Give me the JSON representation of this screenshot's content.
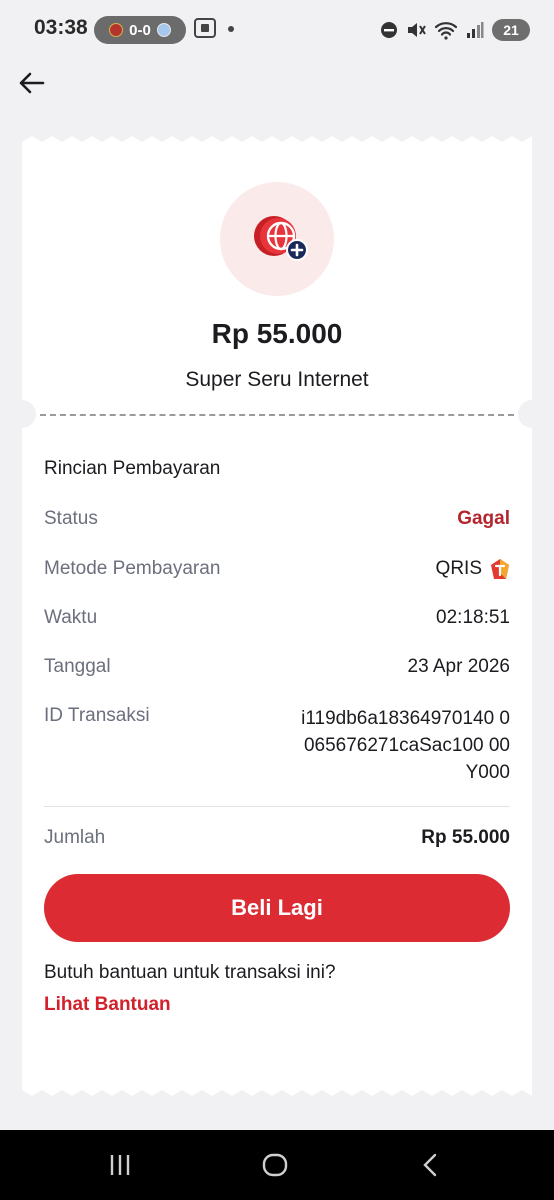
{
  "status_bar": {
    "time": "03:38",
    "score": "0-0",
    "battery": "21"
  },
  "receipt": {
    "amount": "Rp 55.000",
    "product_name": "Super Seru Internet",
    "details_title": "Rincian Pembayaran",
    "status_label": "Status",
    "status_value": "Gagal",
    "method_label": "Metode Pembayaran",
    "method_value": "QRIS",
    "time_label": "Waktu",
    "time_value": "02:18:51",
    "date_label": "Tanggal",
    "date_value": "23 Apr 2026",
    "txid_label": "ID Transaksi",
    "txid_value": "i119db6a18364970140 0065676271caSac100 00Y000",
    "total_label": "Jumlah",
    "total_value": "Rp 55.000",
    "buy_again_label": "Beli Lagi",
    "help_question": "Butuh bantuan untuk transaksi ini?",
    "help_link": "Lihat Bantuan"
  },
  "colors": {
    "accent_red": "#dd2b33",
    "fail_red": "#b3262e",
    "background": "#f1f1f3"
  },
  "icons": {
    "back": "arrow-left-icon",
    "product": "globe-plus-icon",
    "payment": "telkomsel-logo-icon"
  }
}
